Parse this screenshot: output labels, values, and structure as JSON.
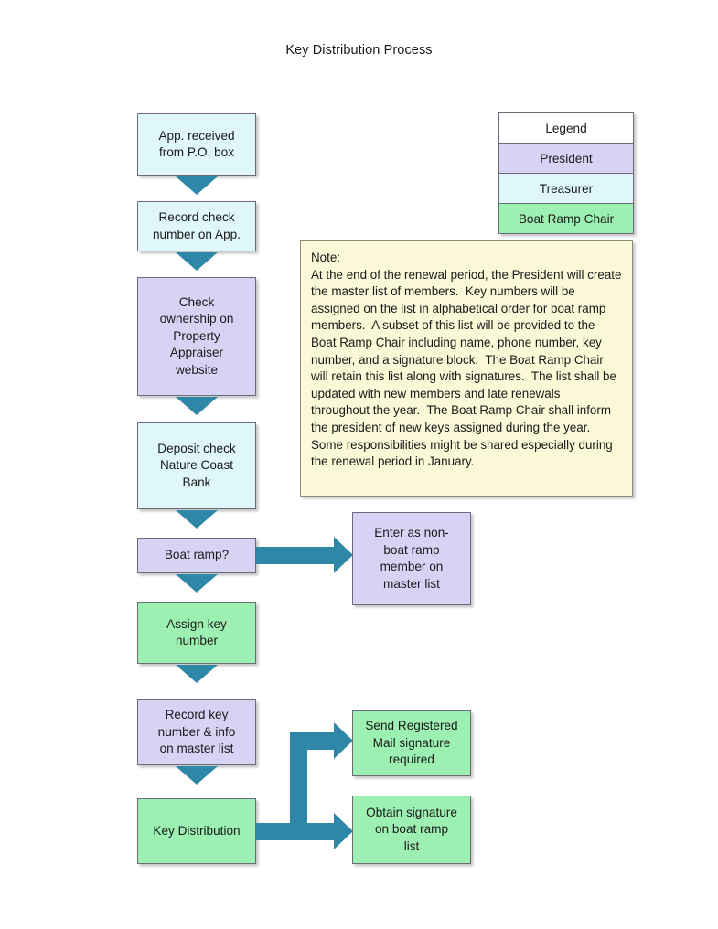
{
  "page": {
    "title": "Key Distribution Process"
  },
  "colors": {
    "treasurer": "#dff7fb",
    "president": "#d6d3f5",
    "boat_ramp_chair": "#9cf0b2",
    "legend_header": "#ffffff",
    "connector": "#2f87a8",
    "note_background": "#faf8d7",
    "node_border": "#6b6b7a"
  },
  "legend": {
    "rows": [
      {
        "label": "Legend",
        "role": "header"
      },
      {
        "label": "President",
        "role": "president"
      },
      {
        "label": "Treasurer",
        "role": "treasurer"
      },
      {
        "label": "Boat Ramp Chair",
        "role": "boat_ramp_chair"
      }
    ]
  },
  "note": {
    "text": "Note:\nAt the end of the renewal period, the President will create the master list of members.  Key numbers will be assigned on the list in alphabetical order for boat ramp members.  A subset of this list will be provided to the Boat Ramp Chair including name, phone number, key number, and a signature block.  The Boat Ramp Chair will retain this list along with signatures.  The list shall be updated with new members and late renewals throughout the year.  The Boat Ramp Chair shall inform the president of new keys assigned during the year.  Some responsibilities might be shared especially during the renewal period in January."
  },
  "flow": {
    "nodes": [
      {
        "id": "app-received",
        "label": "App. received\nfrom P.O. box",
        "role": "treasurer"
      },
      {
        "id": "record-check",
        "label": "Record check\nnumber on App.",
        "role": "treasurer"
      },
      {
        "id": "check-ownership",
        "label": "Check\nownership on\nProperty\nAppraiser\nwebsite",
        "role": "president"
      },
      {
        "id": "deposit-check",
        "label": "Deposit check\nNature Coast\nBank",
        "role": "treasurer"
      },
      {
        "id": "boat-ramp",
        "label": "Boat ramp?",
        "role": "president"
      },
      {
        "id": "enter-non-boat",
        "label": "Enter as non-\nboat ramp\nmember on\nmaster list",
        "role": "president"
      },
      {
        "id": "assign-key",
        "label": "Assign key\nnumber",
        "role": "boat_ramp_chair"
      },
      {
        "id": "record-key",
        "label": "Record key\nnumber & info\non master list",
        "role": "president"
      },
      {
        "id": "key-distribution",
        "label": "Key Distribution",
        "role": "boat_ramp_chair"
      },
      {
        "id": "send-registered",
        "label": "Send Registered\nMail signature\nrequired",
        "role": "boat_ramp_chair"
      },
      {
        "id": "obtain-signature",
        "label": "Obtain signature\non boat ramp\nlist",
        "role": "boat_ramp_chair"
      }
    ]
  }
}
